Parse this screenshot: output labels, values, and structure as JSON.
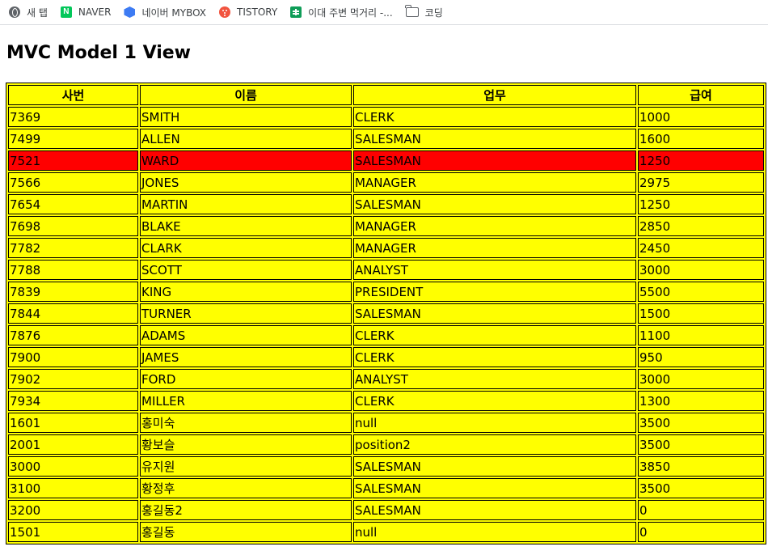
{
  "bookmarks": [
    {
      "icon": "globe-icon",
      "label": "새 탭"
    },
    {
      "icon": "naver-icon",
      "label": "NAVER"
    },
    {
      "icon": "mybox-icon",
      "label": "네이버 MYBOX"
    },
    {
      "icon": "tistory-icon",
      "label": "TISTORY"
    },
    {
      "icon": "sheet-icon",
      "label": "이대 주변 먹거리 -..."
    },
    {
      "icon": "folder-icon",
      "label": "코딩"
    }
  ],
  "page": {
    "title": "MVC Model 1 View"
  },
  "colors": {
    "table_bg": "#ffff00",
    "highlight_row": "#ff0000"
  },
  "table": {
    "headers": [
      "사번",
      "이름",
      "업무",
      "급여"
    ],
    "rows": [
      {
        "empno": "7369",
        "name": "SMITH",
        "job": "CLERK",
        "sal": "1000"
      },
      {
        "empno": "7499",
        "name": "ALLEN",
        "job": "SALESMAN",
        "sal": "1600"
      },
      {
        "empno": "7521",
        "name": "WARD",
        "job": "SALESMAN",
        "sal": "1250",
        "highlight": true
      },
      {
        "empno": "7566",
        "name": "JONES",
        "job": "MANAGER",
        "sal": "2975"
      },
      {
        "empno": "7654",
        "name": "MARTIN",
        "job": "SALESMAN",
        "sal": "1250"
      },
      {
        "empno": "7698",
        "name": "BLAKE",
        "job": "MANAGER",
        "sal": "2850"
      },
      {
        "empno": "7782",
        "name": "CLARK",
        "job": "MANAGER",
        "sal": "2450"
      },
      {
        "empno": "7788",
        "name": "SCOTT",
        "job": "ANALYST",
        "sal": "3000"
      },
      {
        "empno": "7839",
        "name": "KING",
        "job": "PRESIDENT",
        "sal": "5500"
      },
      {
        "empno": "7844",
        "name": "TURNER",
        "job": "SALESMAN",
        "sal": "1500"
      },
      {
        "empno": "7876",
        "name": "ADAMS",
        "job": "CLERK",
        "sal": "1100"
      },
      {
        "empno": "7900",
        "name": "JAMES",
        "job": "CLERK",
        "sal": "950"
      },
      {
        "empno": "7902",
        "name": "FORD",
        "job": "ANALYST",
        "sal": "3000"
      },
      {
        "empno": "7934",
        "name": "MILLER",
        "job": "CLERK",
        "sal": "1300"
      },
      {
        "empno": "1601",
        "name": "홍미숙",
        "job": "null",
        "sal": "3500"
      },
      {
        "empno": "2001",
        "name": "황보슬",
        "job": "position2",
        "sal": "3500"
      },
      {
        "empno": "3000",
        "name": "유지원",
        "job": "SALESMAN",
        "sal": "3850"
      },
      {
        "empno": "3100",
        "name": "황정후",
        "job": "SALESMAN",
        "sal": "3500"
      },
      {
        "empno": "3200",
        "name": "홍길동2",
        "job": "SALESMAN",
        "sal": "0"
      },
      {
        "empno": "1501",
        "name": "홍길동",
        "job": "null",
        "sal": "0"
      }
    ]
  }
}
